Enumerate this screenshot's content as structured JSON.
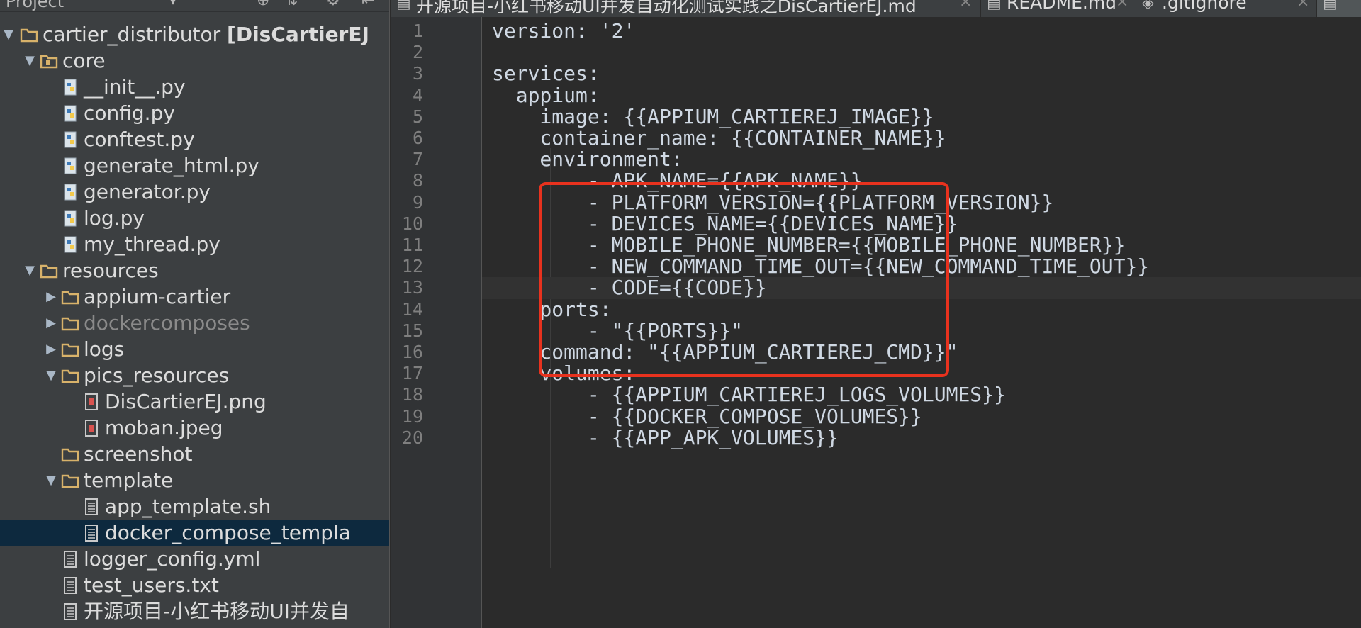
{
  "project_panel": {
    "header_label": "Project",
    "tree": [
      {
        "label": "cartier_distributor",
        "bold_suffix": "[DisCartierEJ",
        "type": "folder",
        "state": "expanded",
        "depth": 0
      },
      {
        "label": "core",
        "type": "package",
        "state": "expanded",
        "depth": 1
      },
      {
        "label": "__init__.py",
        "type": "python",
        "state": "leaf",
        "depth": 2
      },
      {
        "label": "config.py",
        "type": "python",
        "state": "leaf",
        "depth": 2
      },
      {
        "label": "conftest.py",
        "type": "python",
        "state": "leaf",
        "depth": 2
      },
      {
        "label": "generate_html.py",
        "type": "python",
        "state": "leaf",
        "depth": 2
      },
      {
        "label": "generator.py",
        "type": "python",
        "state": "leaf",
        "depth": 2
      },
      {
        "label": "log.py",
        "type": "python",
        "state": "leaf",
        "depth": 2
      },
      {
        "label": "my_thread.py",
        "type": "python",
        "state": "leaf",
        "depth": 2
      },
      {
        "label": "resources",
        "type": "folder",
        "state": "expanded",
        "depth": 1
      },
      {
        "label": "appium-cartier",
        "type": "folder",
        "state": "collapsed",
        "depth": 2
      },
      {
        "label": "dockercomposes",
        "type": "folder",
        "state": "collapsed",
        "depth": 2,
        "dim": true
      },
      {
        "label": "logs",
        "type": "folder",
        "state": "collapsed",
        "depth": 2
      },
      {
        "label": "pics_resources",
        "type": "folder",
        "state": "expanded",
        "depth": 2
      },
      {
        "label": "DisCartierEJ.png",
        "type": "image",
        "state": "leaf",
        "depth": 3
      },
      {
        "label": "moban.jpeg",
        "type": "image",
        "state": "leaf",
        "depth": 3
      },
      {
        "label": "screenshot",
        "type": "folder",
        "state": "leaf",
        "depth": 2
      },
      {
        "label": "template",
        "type": "folder",
        "state": "expanded",
        "depth": 2
      },
      {
        "label": "app_template.sh",
        "type": "text",
        "state": "leaf",
        "depth": 3
      },
      {
        "label": "docker_compose_templa",
        "type": "text",
        "state": "leaf",
        "depth": 3,
        "selected": true
      },
      {
        "label": "logger_config.yml",
        "type": "text",
        "state": "leaf",
        "depth": 2
      },
      {
        "label": "test_users.txt",
        "type": "text",
        "state": "leaf",
        "depth": 2
      },
      {
        "label": "开源项目-小红书移动UI并发自",
        "type": "text",
        "state": "leaf",
        "depth": 2
      }
    ]
  },
  "tabs": [
    {
      "label": "开源项目-小红书移动UI并发自动化测试实践之DisCartierEJ.md",
      "icon": "markdown-icon",
      "close": "×",
      "active": false
    },
    {
      "label": "README.md",
      "icon": "markdown-icon",
      "close": "×",
      "active": false
    },
    {
      "label": ".gitignore",
      "icon": "gitignore-icon",
      "close": "×",
      "active": false
    },
    {
      "label": "",
      "icon": "file-icon",
      "close": "",
      "active": true
    }
  ],
  "editor": {
    "lines": [
      "version: '2'",
      "",
      "services:",
      "  appium:",
      "    image: {{APPIUM_CARTIEREJ_IMAGE}}",
      "    container_name: {{CONTAINER_NAME}}",
      "    environment:",
      "        - APK_NAME={{APK_NAME}}",
      "        - PLATFORM_VERSION={{PLATFORM_VERSION}}",
      "        - DEVICES_NAME={{DEVICES_NAME}}",
      "        - MOBILE_PHONE_NUMBER={{MOBILE_PHONE_NUMBER}}",
      "        - NEW_COMMAND_TIME_OUT={{NEW_COMMAND_TIME_OUT}}",
      "        - CODE={{CODE}}",
      "    ports:",
      "        - \"{{PORTS}}\"",
      "    command: \"{{APPIUM_CARTIEREJ_CMD}}\"",
      "    volumes:",
      "        - {{APPIUM_CARTIEREJ_LOGS_VOLUMES}}",
      "        - {{DOCKER_COMPOSE_VOLUMES}}",
      "        - {{APP_APK_VOLUMES}}"
    ],
    "current_line": 13,
    "highlight": {
      "from_line": 7,
      "to_line": 13,
      "color": "#e8321e"
    }
  },
  "colors": {
    "panel_bg": "#3c3f41",
    "editor_bg": "#2b2b2b",
    "gutter_bg": "#313335",
    "selection": "#0d293e",
    "text": "#cfd8e3",
    "line_number": "#7f7f7f",
    "highlight_border": "#e8321e"
  }
}
